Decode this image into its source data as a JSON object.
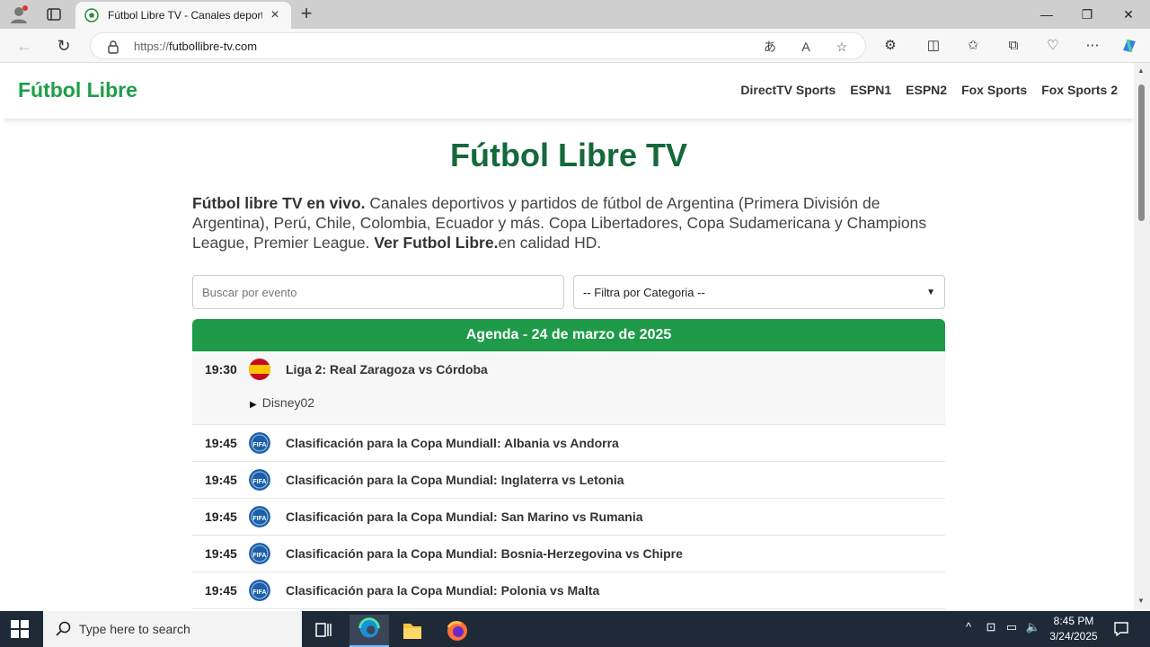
{
  "browser": {
    "tab_title": "Fútbol Libre TV - Canales deportivos",
    "url_prefix": "https://",
    "url_host": "futbollibre-tv.com"
  },
  "site": {
    "logo": "Fútbol Libre",
    "nav": [
      "DirectTV Sports",
      "ESPN1",
      "ESPN2",
      "Fox Sports",
      "Fox Sports 2"
    ],
    "heading": "Fútbol Libre TV",
    "intro": {
      "bold1": "Fútbol libre TV en vivo.",
      "text1": " Canales deportivos y partidos de fútbol de Argentina (Primera División de Argentina), Perú, Chile, Colombia, Ecuador y más. Copa Libertadores, Copa Sudamericana y Champions League, Premier League. ",
      "bold2": "Ver Futbol Libre.",
      "text2": "en calidad HD."
    },
    "search_placeholder": "Buscar por evento",
    "filter_selected": "-- Filtra por Categoria --",
    "agenda_title": "Agenda - 24 de marzo de 2025",
    "events": [
      {
        "time": "19:30",
        "flag": "spain-flag-icon",
        "name": "Liga 2: Real Zaragoza vs Córdoba",
        "channel": "Disney02"
      },
      {
        "time": "19:45",
        "flag": "fifa-icon",
        "name": "Clasificación para la Copa Mundiall: Albania vs Andorra"
      },
      {
        "time": "19:45",
        "flag": "fifa-icon",
        "name": "Clasificación para la Copa Mundial: Inglaterra vs Letonia"
      },
      {
        "time": "19:45",
        "flag": "fifa-icon",
        "name": "Clasificación para la Copa Mundial: San Marino vs Rumania"
      },
      {
        "time": "19:45",
        "flag": "fifa-icon",
        "name": "Clasificación para la Copa Mundial: Bosnia-Herzegovina vs Chipre"
      },
      {
        "time": "19:45",
        "flag": "fifa-icon",
        "name": "Clasificación para la Copa Mundial: Polonia vs Malta"
      }
    ]
  },
  "taskbar": {
    "search_text": "Type here to search",
    "time": "8:45 PM",
    "date": "3/24/2025"
  }
}
